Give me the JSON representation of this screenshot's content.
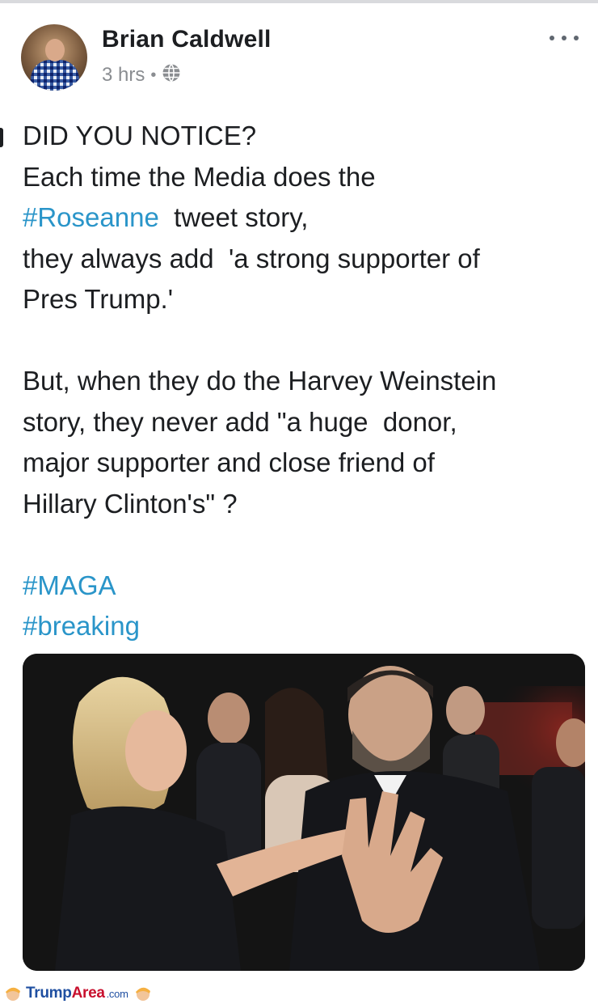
{
  "post": {
    "author": "Brian Caldwell",
    "time": "3 hrs",
    "separator": "•",
    "privacy_icon": "globe-icon",
    "more_icon": "more-options-icon",
    "lines": [
      [
        {
          "t": "DID YOU NOTICE?",
          "tag": false
        }
      ],
      [
        {
          "t": "Each time the Media does the",
          "tag": false
        }
      ],
      [
        {
          "t": "#Roseanne",
          "tag": true
        },
        {
          "t": "  tweet story,",
          "tag": false
        }
      ],
      [
        {
          "t": "they always add  'a strong supporter of",
          "tag": false
        }
      ],
      [
        {
          "t": "Pres Trump.'",
          "tag": false
        }
      ],
      [],
      [
        {
          "t": "But, when they do the Harvey Weinstein",
          "tag": false
        }
      ],
      [
        {
          "t": "story, they never add \"a huge  donor,",
          "tag": false
        }
      ],
      [
        {
          "t": "major supporter and close friend of",
          "tag": false
        }
      ],
      [
        {
          "t": "Hillary Clinton's\" ?",
          "tag": false
        }
      ],
      [],
      [
        {
          "t": "#MAGA",
          "tag": true
        }
      ],
      [
        {
          "t": "#breaking",
          "tag": true
        }
      ]
    ],
    "hashtag_color": "#2a95c9"
  },
  "footer": {
    "brand_part1": "Trump",
    "brand_part2": "Area",
    "brand_part3": ".com",
    "brand_blue": "#1f4fa1",
    "brand_red": "#c8102e"
  }
}
